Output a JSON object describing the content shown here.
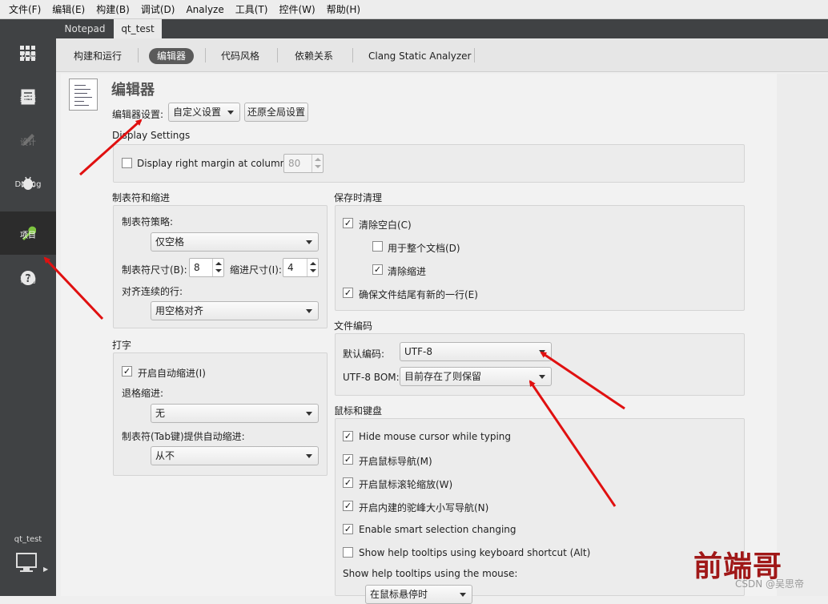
{
  "menu": [
    "文件(F)",
    "编辑(E)",
    "构建(B)",
    "调试(D)",
    "Analyze",
    "工具(T)",
    "控件(W)",
    "帮助(H)"
  ],
  "modes": [
    {
      "label": "欢迎",
      "icon": "grid-icon"
    },
    {
      "label": "编辑",
      "icon": "document-icon"
    },
    {
      "label": "设计",
      "icon": "pencil-icon",
      "disabled": true
    },
    {
      "label": "Debug",
      "icon": "bug-icon"
    },
    {
      "label": "项目",
      "icon": "wrench-icon",
      "active": true
    },
    {
      "label": "帮助",
      "icon": "help-icon"
    }
  ],
  "project_selector": {
    "label": "qt_test"
  },
  "tabs": [
    "Notepad",
    "qt_test"
  ],
  "subtabs": [
    "构建和运行",
    "编辑器",
    "代码风格",
    "依赖关系",
    "Clang Static Analyzer"
  ],
  "page": {
    "title": "编辑器",
    "settings_label": "编辑器设置:",
    "settings_value": "自定义设置",
    "restore_button": "还原全局设置"
  },
  "display": {
    "section": "Display Settings",
    "right_margin_label": "Display right margin at column:",
    "right_margin_value": "80",
    "right_margin_checked": false
  },
  "tabs_indent": {
    "section": "制表符和缩进",
    "policy_label": "制表符策略:",
    "policy_value": "仅空格",
    "tab_size_label": "制表符尺寸(B):",
    "tab_size_value": "8",
    "indent_size_label": "缩进尺寸(I):",
    "indent_size_value": "4",
    "align_label": "对齐连续的行:",
    "align_value": "用空格对齐"
  },
  "typing": {
    "section": "打字",
    "auto_indent_label": "开启自动缩进(I)",
    "backspace_label": "退格缩进:",
    "backspace_value": "无",
    "tab_key_label": "制表符(Tab键)提供自动缩进:",
    "tab_key_value": "从不"
  },
  "cleanup": {
    "section": "保存时清理",
    "items": [
      {
        "label": "清除空白(C)",
        "checked": true
      },
      {
        "label": "用于整个文档(D)",
        "checked": false
      },
      {
        "label": "清除缩进",
        "checked": true
      },
      {
        "label": "确保文件结尾有新的一行(E)",
        "checked": true
      }
    ]
  },
  "encoding": {
    "section": "文件编码",
    "default_label": "默认编码:",
    "default_value": "UTF-8",
    "bom_label": "UTF-8 BOM:",
    "bom_value": "目前存在了则保留"
  },
  "mouse": {
    "section": "鼠标和键盘",
    "items": [
      {
        "label": "Hide mouse cursor while typing",
        "checked": true
      },
      {
        "label": "开启鼠标导航(M)",
        "checked": true
      },
      {
        "label": "开启鼠标滚轮缩放(W)",
        "checked": true
      },
      {
        "label": "开启内建的驼峰大小写导航(N)",
        "checked": true
      },
      {
        "label": "Enable smart selection changing",
        "checked": true
      },
      {
        "label": "Show help tooltips using keyboard shortcut (Alt)",
        "checked": false
      }
    ],
    "tooltip_label": "Show help tooltips using the mouse:",
    "tooltip_value": "在鼠标悬停时"
  },
  "watermark": {
    "logo_text": "前端哥",
    "credit": "CSDN @吴思帝"
  },
  "colors": {
    "modebar": "#404244",
    "annotation_arrow": "#e01010",
    "watermark": "#a01818"
  }
}
